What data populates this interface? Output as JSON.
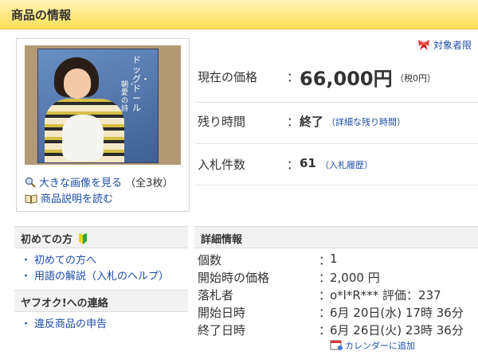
{
  "header": {
    "title": "商品の情報"
  },
  "image_panel": {
    "sleeve_title": "ドッグ・ドール",
    "sleeve_subtitle": "朝・愛の詩",
    "large_image_link": "大きな画像を見る",
    "image_count": "（全3枚）",
    "description_link": "商品説明を読む"
  },
  "target_badge": {
    "label": "対象者限"
  },
  "summary": {
    "price_label": "現在の価格",
    "colon": "：",
    "price_value": "66,000円",
    "tax_note": "（税0円）",
    "time_label": "残り時間",
    "time_value": "終了",
    "time_link": "（詳細な残り時間）",
    "bids_label": "入札件数",
    "bids_value": "61",
    "bids_link": "（入札履歴）"
  },
  "sidebar": {
    "section1_title": "初めての方",
    "section1_items": [
      "初めての方へ",
      "用語の解説（入札のヘルプ）"
    ],
    "section2_title": "ヤフオク!への連絡",
    "section2_items": [
      "違反商品の申告"
    ],
    "bullet": "・"
  },
  "details": {
    "title": "詳細情報",
    "rows": [
      {
        "label": "個数",
        "value": "1"
      },
      {
        "label": "開始時の価格",
        "value": "2,000 円"
      },
      {
        "label": "落札者",
        "value": "o*l*R*** 評価：237"
      },
      {
        "label": "開始日時",
        "value": "6月 20日(水) 17時 36分"
      },
      {
        "label": "終了日時",
        "value": "6月 26日(火) 23時 36分"
      }
    ],
    "colon": "：",
    "calendar_link": "カレンダーに追加"
  },
  "colors": {
    "link": "#1c4ca8",
    "header_bg": "#ffe05a"
  }
}
